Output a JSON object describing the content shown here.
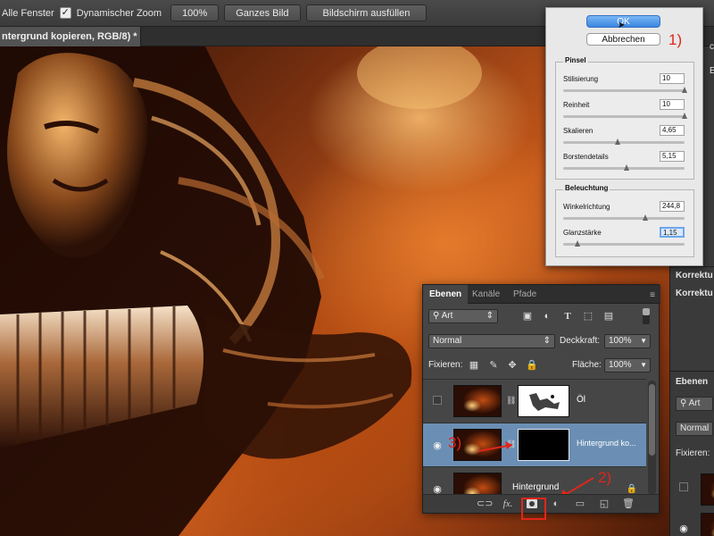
{
  "options_bar": {
    "all_windows_label": "Alle Fenster",
    "dynamic_zoom_label": "Dynamischer Zoom",
    "checkmark": "✓",
    "zoom_100": "100%",
    "fit_screen": "Ganzes Bild",
    "fill_screen": "Bildschirm ausfüllen"
  },
  "document": {
    "tab_title": "ntergrund kopieren, RGB/8) *"
  },
  "dialog": {
    "ok_label": "OK",
    "cancel_label": "Abbrechen",
    "annotation_1": "1)",
    "brush_group": {
      "title": "Pinsel",
      "params": [
        {
          "label": "Stilisierung",
          "value": "10",
          "level": 1.0
        },
        {
          "label": "Reinheit",
          "value": "10",
          "level": 1.0
        },
        {
          "label": "Skalieren",
          "value": "4,65",
          "level": 0.45
        },
        {
          "label": "Borstendetails",
          "value": "5,15",
          "level": 0.52
        }
      ]
    },
    "lighting_group": {
      "title": "Beleuchtung",
      "params": [
        {
          "label": "Winkelrichtung",
          "value": "244,8",
          "level": 0.68
        },
        {
          "label": "Glanzstärke",
          "value": "1,15",
          "level": 0.12
        }
      ]
    }
  },
  "right_panel": {
    "top_label_1": "ch",
    "top_label_2": "Eig",
    "korrektur_1": "Korrektu",
    "korrektur_2": "Korrektu",
    "ebenen_tab": "Ebenen",
    "art_filter": "Art",
    "blend_mode": "Normal",
    "fixieren": "Fixieren:"
  },
  "layers_panel": {
    "tabs": [
      "Ebenen",
      "Kanäle",
      "Pfade"
    ],
    "menu_icon": "≡",
    "kind_filter": "Art",
    "blend_mode": "Normal",
    "opacity_label": "Deckkraft:",
    "opacity_value": "100%",
    "lock_label": "Fixieren:",
    "fill_label": "Fläche:",
    "fill_value": "100%",
    "layers": [
      {
        "name": "Öl",
        "visible": false,
        "has_mask": true,
        "mask_type": "white",
        "selected": false,
        "locked": false
      },
      {
        "name": "Hintergrund ko...",
        "visible": true,
        "has_mask": true,
        "mask_type": "black",
        "selected": true,
        "locked": false
      },
      {
        "name": "Hintergrund",
        "visible": true,
        "has_mask": false,
        "selected": false,
        "locked": true
      }
    ],
    "annotation_2": "2)",
    "annotation_3": "3)",
    "bottom_icons": [
      "link-icon",
      "fx-icon",
      "add-mask-icon",
      "adjustment-icon",
      "folder-icon",
      "new-layer-icon",
      "trash-icon"
    ],
    "fx_label": "fx."
  },
  "colors": {
    "accent_red": "#e0261a",
    "selection_blue": "#6b8fb4",
    "ok_blue": "#3b86e0"
  }
}
